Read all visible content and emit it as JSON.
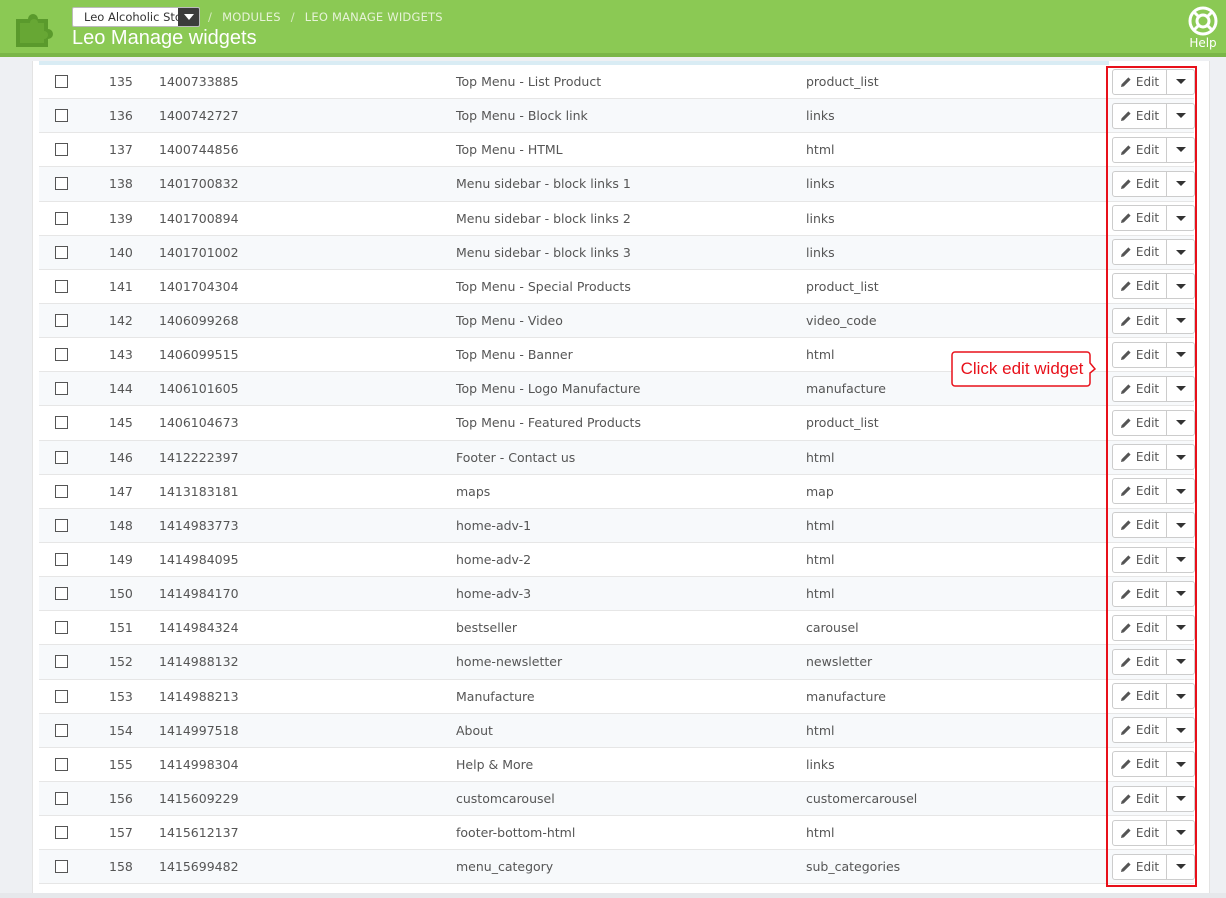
{
  "header": {
    "store_selector": "Leo Alcoholic Sto",
    "breadcrumb": [
      "MODULES",
      "LEO MANAGE WIDGETS"
    ],
    "breadcrumb_separator": "/",
    "title": "Leo Manage widgets",
    "help_label": "Help",
    "colors": {
      "header_bg": "#8bc954",
      "annotation": "#e8101a"
    }
  },
  "table": {
    "edit_label": "Edit",
    "rows": [
      {
        "id": "135",
        "key": "1400733885",
        "name": "Top Menu - List Product",
        "type": "product_list"
      },
      {
        "id": "136",
        "key": "1400742727",
        "name": "Top Menu - Block link",
        "type": "links"
      },
      {
        "id": "137",
        "key": "1400744856",
        "name": "Top Menu - HTML",
        "type": "html"
      },
      {
        "id": "138",
        "key": "1401700832",
        "name": "Menu sidebar - block links 1",
        "type": "links"
      },
      {
        "id": "139",
        "key": "1401700894",
        "name": "Menu sidebar - block links 2",
        "type": "links"
      },
      {
        "id": "140",
        "key": "1401701002",
        "name": "Menu sidebar - block links 3",
        "type": "links"
      },
      {
        "id": "141",
        "key": "1401704304",
        "name": "Top Menu - Special Products",
        "type": "product_list"
      },
      {
        "id": "142",
        "key": "1406099268",
        "name": "Top Menu - Video",
        "type": "video_code"
      },
      {
        "id": "143",
        "key": "1406099515",
        "name": "Top Menu - Banner",
        "type": "html"
      },
      {
        "id": "144",
        "key": "1406101605",
        "name": "Top Menu - Logo Manufacture",
        "type": "manufacture"
      },
      {
        "id": "145",
        "key": "1406104673",
        "name": "Top Menu - Featured Products",
        "type": "product_list"
      },
      {
        "id": "146",
        "key": "1412222397",
        "name": "Footer - Contact us",
        "type": "html"
      },
      {
        "id": "147",
        "key": "1413183181",
        "name": "maps",
        "type": "map"
      },
      {
        "id": "148",
        "key": "1414983773",
        "name": "home-adv-1",
        "type": "html"
      },
      {
        "id": "149",
        "key": "1414984095",
        "name": "home-adv-2",
        "type": "html"
      },
      {
        "id": "150",
        "key": "1414984170",
        "name": "home-adv-3",
        "type": "html"
      },
      {
        "id": "151",
        "key": "1414984324",
        "name": "bestseller",
        "type": "carousel"
      },
      {
        "id": "152",
        "key": "1414988132",
        "name": "home-newsletter",
        "type": "newsletter"
      },
      {
        "id": "153",
        "key": "1414988213",
        "name": "Manufacture",
        "type": "manufacture"
      },
      {
        "id": "154",
        "key": "1414997518",
        "name": "About",
        "type": "html"
      },
      {
        "id": "155",
        "key": "1414998304",
        "name": "Help & More",
        "type": "links"
      },
      {
        "id": "156",
        "key": "1415609229",
        "name": "customcarousel",
        "type": "customercarousel"
      },
      {
        "id": "157",
        "key": "1415612137",
        "name": "footer-bottom-html",
        "type": "html"
      },
      {
        "id": "158",
        "key": "1415699482",
        "name": "menu_category",
        "type": "sub_categories"
      }
    ]
  },
  "annotation": {
    "callout_text": "Click edit widget"
  }
}
